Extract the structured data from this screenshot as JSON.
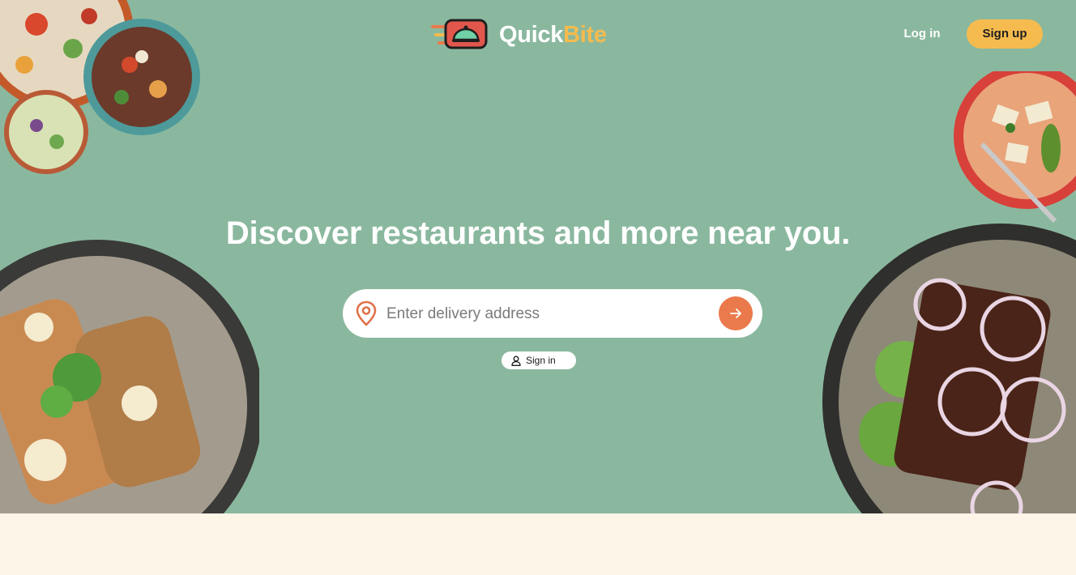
{
  "brand": {
    "name_part1": "Quick",
    "name_part2": "Bite",
    "colors": {
      "hero_bg": "#8ab89f",
      "accent_yellow": "#f6bb4e",
      "accent_orange": "#ea7a4c",
      "page_bg": "#fdf5e7"
    }
  },
  "nav": {
    "login_label": "Log in",
    "signup_label": "Sign up"
  },
  "hero": {
    "headline": "Discover restaurants and more near you."
  },
  "search": {
    "placeholder": "Enter delivery address",
    "value": "",
    "location_icon": "location-pin-icon",
    "submit_icon": "arrow-right-icon"
  },
  "signin": {
    "label": "Sign in",
    "icon": "user-icon"
  }
}
